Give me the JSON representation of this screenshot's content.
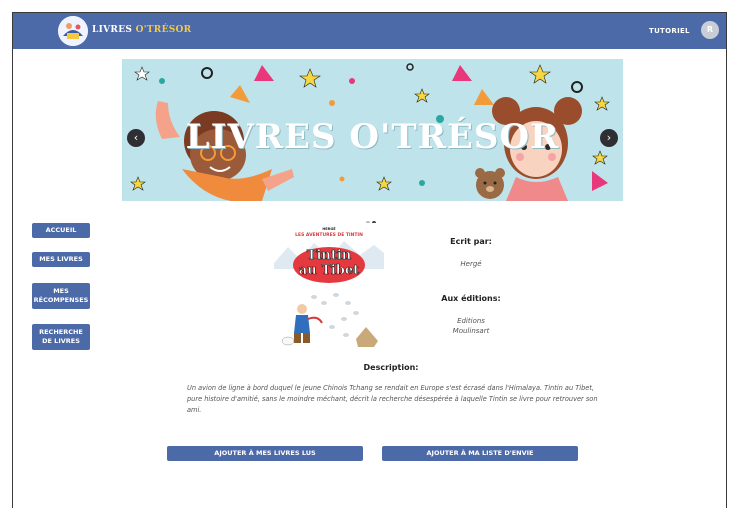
{
  "header": {
    "brand_main": "LIVRES ",
    "brand_accent": "O'TRÉSOR",
    "tutoriel_label": "TUTORIEL",
    "avatar_initial": "R"
  },
  "carousel": {
    "title": "LIVRES O'TRÉSOR",
    "prev_glyph": "‹",
    "next_glyph": "›",
    "slide_count": 2,
    "active_slide": 2
  },
  "sidebar": {
    "items": [
      {
        "label": "ACCUEIL"
      },
      {
        "label": "MES LIVRES"
      },
      {
        "label": "MES RÉCOMPENSES"
      },
      {
        "label": "RECHERCHE DE LIVRES"
      }
    ]
  },
  "book": {
    "cover_series": "LES AVENTURES DE TINTIN",
    "cover_author": "HERGÉ",
    "cover_title_line1": "Tintin",
    "cover_title_line2": "au Tibet",
    "author_label": "Ecrit par:",
    "author": "Hergé",
    "publisher_label": "Aux éditions:",
    "publisher_line1": "Editions",
    "publisher_line2": "Moulinsart",
    "description_label": "Description:",
    "description": "Un avion de ligne à bord duquel le jeune Chinois Tchang se rendait en Europe s'est écrasé dans l'Himalaya. Tintin au Tibet, pure histoire d'amitié, sans le moindre méchant, décrit la recherche désespérée à laquelle Tintin se livre pour retrouver son ami."
  },
  "actions": {
    "read_label": "AJOUTER À MES LIVRES LUS",
    "wishlist_label": "AJOUTER À MA LISTE D'ENVIE"
  },
  "colors": {
    "primary": "#4c6aa8",
    "banner_bg": "#bfe3ea",
    "accent_yellow": "#f5c842"
  }
}
